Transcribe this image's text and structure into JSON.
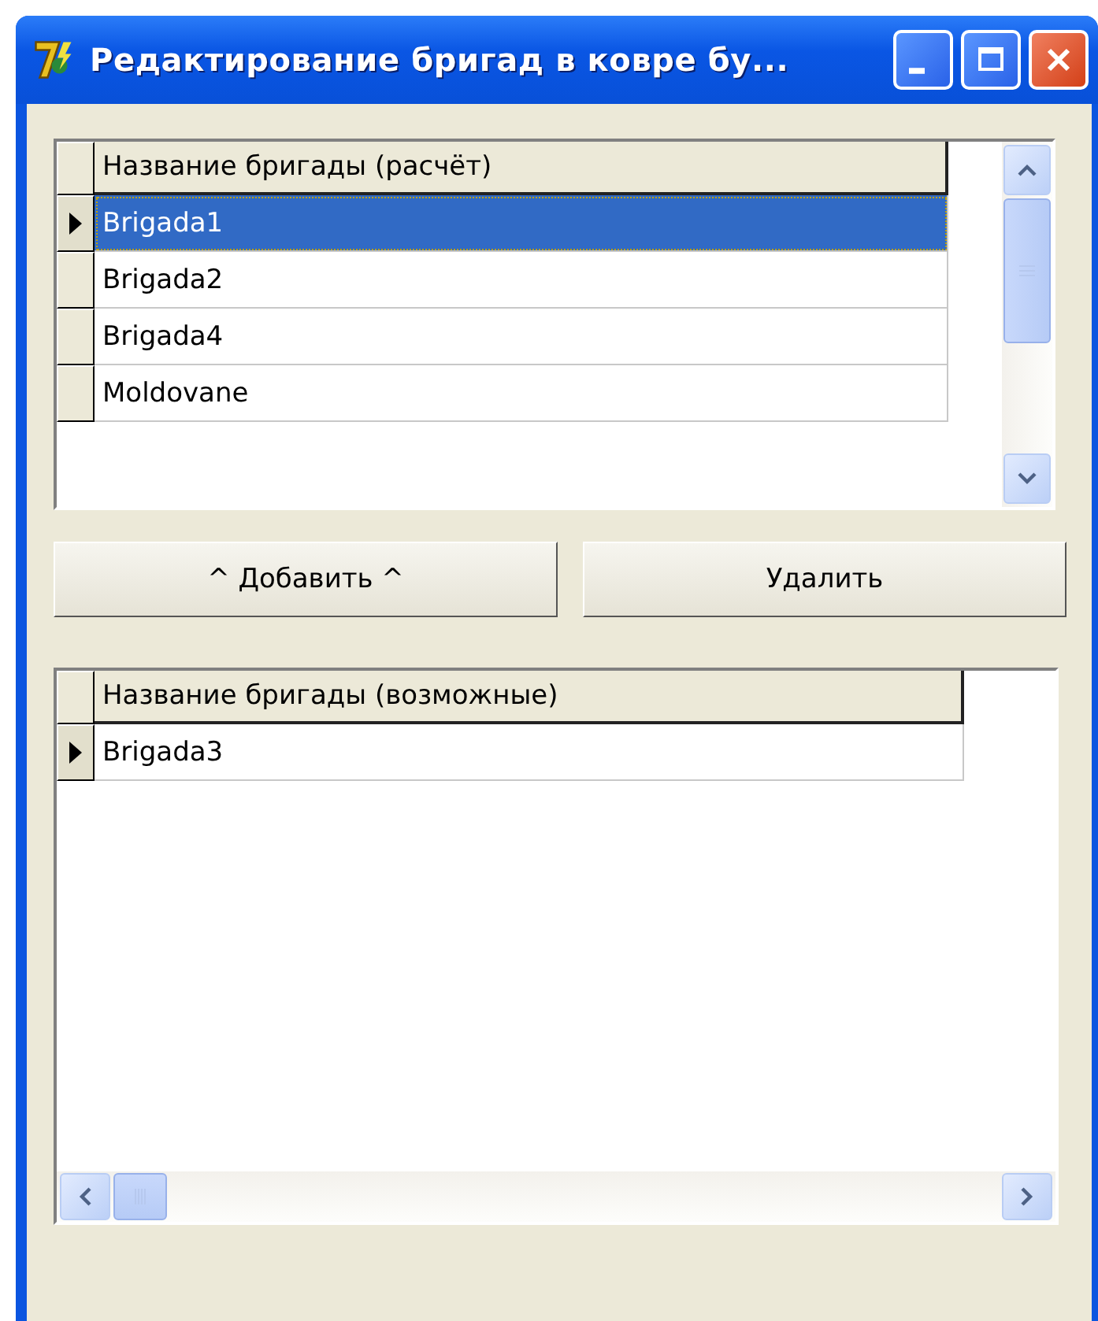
{
  "window": {
    "title": "Редактирование бригад в ковре бу..."
  },
  "selected_grid": {
    "columns": [
      "Название бригады (расчёт)"
    ],
    "rows": [
      {
        "cells": [
          "Brigada1"
        ],
        "selected": true,
        "current": true
      },
      {
        "cells": [
          "Brigada2"
        ],
        "selected": false,
        "current": false
      },
      {
        "cells": [
          "Brigada4"
        ],
        "selected": false,
        "current": false
      },
      {
        "cells": [
          "Moldovane"
        ],
        "selected": false,
        "current": false
      }
    ]
  },
  "buttons": [
    "^ Добавить ^",
    "Удалить"
  ],
  "available_grid": {
    "columns": [
      "Название бригады (возможные)"
    ],
    "rows": [
      {
        "cells": [
          "Brigada3"
        ],
        "selected": false,
        "current": true
      }
    ]
  }
}
